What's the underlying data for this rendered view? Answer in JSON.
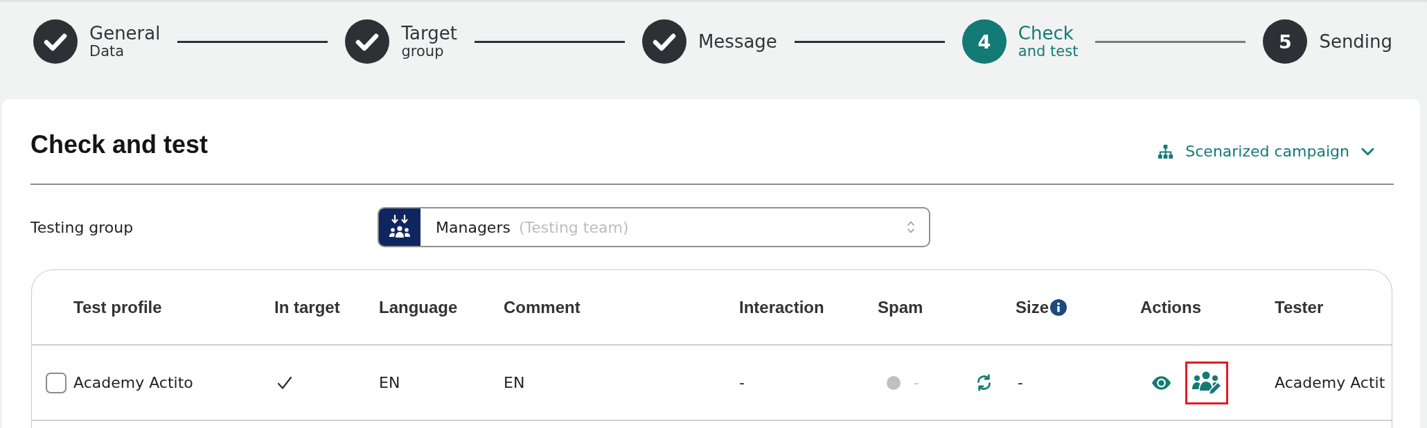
{
  "stepper": {
    "steps": [
      {
        "title": "General",
        "subtitle": "Data",
        "done": true,
        "current": false
      },
      {
        "title": "Target",
        "subtitle": "group",
        "done": true,
        "current": false
      },
      {
        "title": "Message",
        "done": true,
        "current": false
      },
      {
        "number": "4",
        "title": "Check",
        "subtitle": "and test",
        "done": false,
        "current": true
      },
      {
        "number": "5",
        "title": "Sending",
        "done": false,
        "current": false
      }
    ]
  },
  "card": {
    "title": "Check and test",
    "campaign_menu": {
      "label": "Scenarized campaign"
    },
    "testing_group": {
      "label": "Testing group",
      "value": "Managers",
      "note": "(Testing team)"
    },
    "table": {
      "columns": [
        {
          "label": "Test profile",
          "info": false
        },
        {
          "label": "In target",
          "info": false
        },
        {
          "label": "Language",
          "info": false
        },
        {
          "label": "Comment",
          "info": false
        },
        {
          "label": "Interaction",
          "info": false
        },
        {
          "label": "Spam",
          "info": false
        },
        {
          "label": "Size",
          "info": true
        },
        {
          "label": "Actions",
          "info": false
        },
        {
          "label": "Tester",
          "info": false
        }
      ],
      "rows": [
        {
          "checked": false,
          "test_profile": "Academy Actito",
          "in_target": true,
          "language": "EN",
          "comment": "EN",
          "interaction": "-",
          "spam": {
            "color": "#c0c0c0",
            "score": "-"
          },
          "size": "-",
          "actions": [
            {
              "kind": "preview",
              "highlighted": false
            },
            {
              "kind": "edit_testers",
              "highlighted": true
            }
          ],
          "tester": "Academy Actit"
        }
      ]
    }
  }
}
